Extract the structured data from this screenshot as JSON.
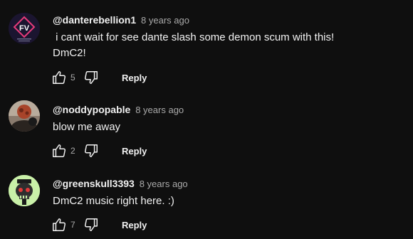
{
  "comments": [
    {
      "author": "@danterebellion1",
      "time": "8 years ago",
      "text": " i cant wait for see dante slash some demon scum with this! DmC2!",
      "likes": "5",
      "reply_label": "Reply",
      "avatar_text": "FV"
    },
    {
      "author": "@noddypopable",
      "time": "8 years ago",
      "text": "blow me away",
      "likes": "2",
      "reply_label": "Reply"
    },
    {
      "author": "@greenskull3393",
      "time": "8 years ago",
      "text": "DmC2 music right here. :)",
      "likes": "7",
      "reply_label": "Reply"
    }
  ],
  "icons": {
    "like": "thumb-up-icon",
    "dislike": "thumb-down-icon"
  },
  "colors": {
    "background": "#0f0f0f",
    "text": "#f1f1f1",
    "secondary_text": "#aaaaaa",
    "avatar1_bg": "#1b1530",
    "avatar1_accent": "#e63a7a",
    "avatar3_bg": "#c9f0a8"
  }
}
